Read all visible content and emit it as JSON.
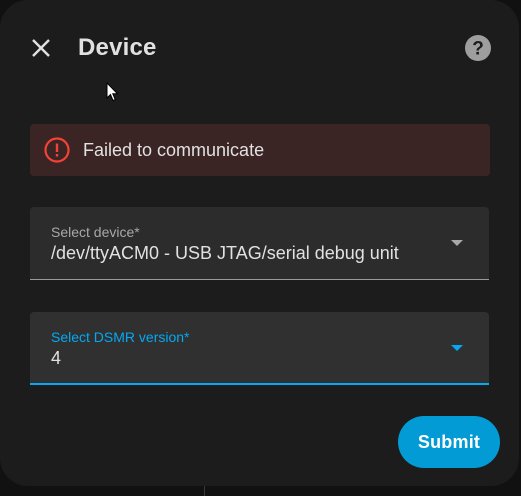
{
  "dialog": {
    "title": "Device",
    "close_icon": "close-icon",
    "help_icon": "help-icon"
  },
  "alert": {
    "icon": "error-icon",
    "message": "Failed to communicate",
    "color": "#f44336"
  },
  "fields": {
    "device": {
      "label": "Select device*",
      "value": "/dev/ttyACM0 - USB JTAG/serial debug unit"
    },
    "dsmr": {
      "label": "Select DSMR version*",
      "value": "4"
    }
  },
  "actions": {
    "submit_label": "Submit"
  },
  "colors": {
    "accent": "#03a9f4",
    "submit_bg": "#039bd5",
    "alert_bg": "#3a2424"
  }
}
